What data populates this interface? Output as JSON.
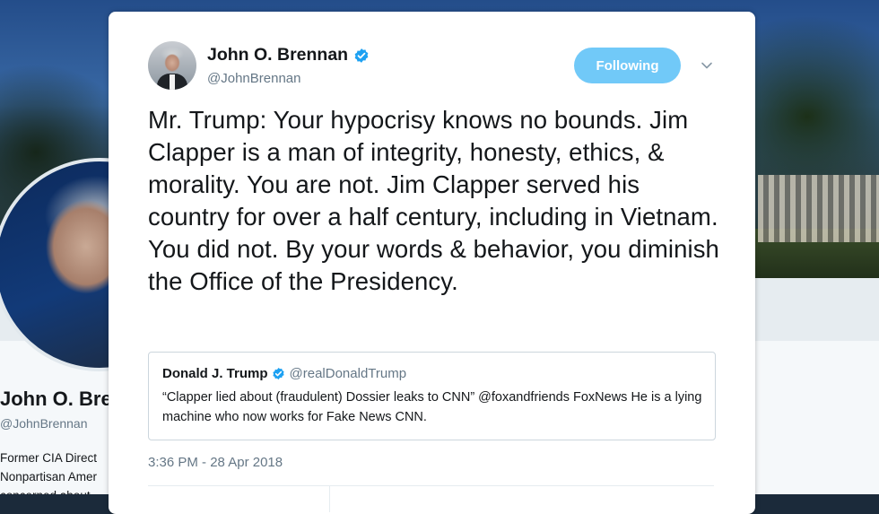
{
  "background_profile": {
    "name": "John O. Bre",
    "handle": "@JohnBrennan",
    "bio_lines": [
      "Former CIA Direct",
      "Nonpartisan Amer",
      "concerned about"
    ]
  },
  "tweet": {
    "author_name": "John O. Brennan",
    "author_handle": "@JohnBrennan",
    "follow_label": "Following",
    "text": "Mr. Trump: Your hypocrisy knows no bounds. Jim Clapper is a man of integrity, honesty, ethics, & morality. You are not. Jim Clapper served his country for over a half century, including in Vietnam. You did not. By your words & behavior, you diminish the Office of the Presidency.",
    "timestamp": "3:36 PM - 28 Apr 2018",
    "quoted": {
      "author_name": "Donald J. Trump",
      "author_handle": "@realDonaldTrump",
      "text": "“Clapper lied about (fraudulent) Dossier leaks to CNN” @foxandfriends FoxNews  He is a lying machine who now works for Fake News CNN."
    }
  },
  "icons": {
    "verified": "verified-badge-icon",
    "caret": "chevron-down-icon"
  },
  "colors": {
    "accent": "#1da1f2",
    "follow_button": "#71c9f8",
    "text_primary": "#14171a",
    "text_secondary": "#657786"
  }
}
